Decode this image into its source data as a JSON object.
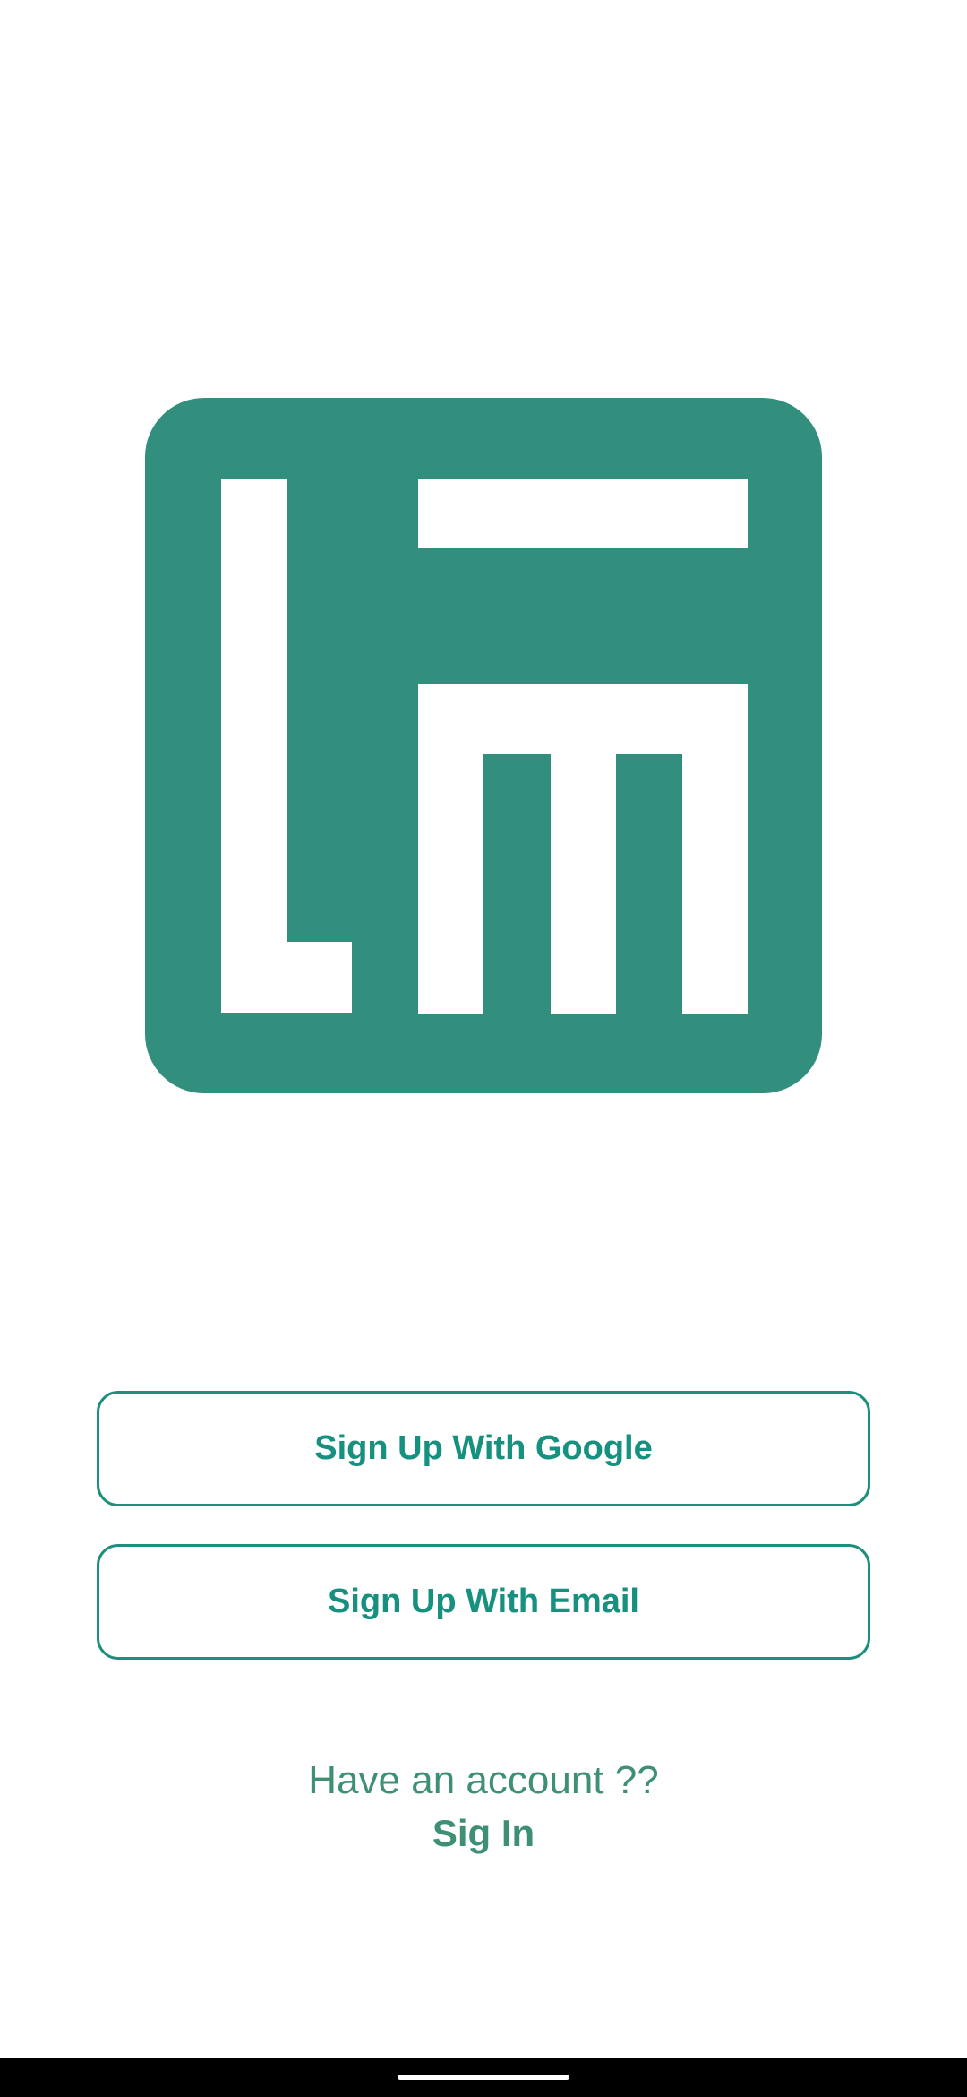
{
  "app": {
    "logo_name": "app-logo",
    "brand_color": "#338f7d"
  },
  "actions": {
    "google_label": "Sign Up With Google",
    "email_label": "Sign Up With Email"
  },
  "footer": {
    "prompt": "Have an account ??",
    "sign_in_label": "Sig In"
  },
  "colors": {
    "button_border": "#1e8f7d",
    "button_text": "#16907f",
    "footer_text": "#3f8f72",
    "background": "#ffffff"
  }
}
